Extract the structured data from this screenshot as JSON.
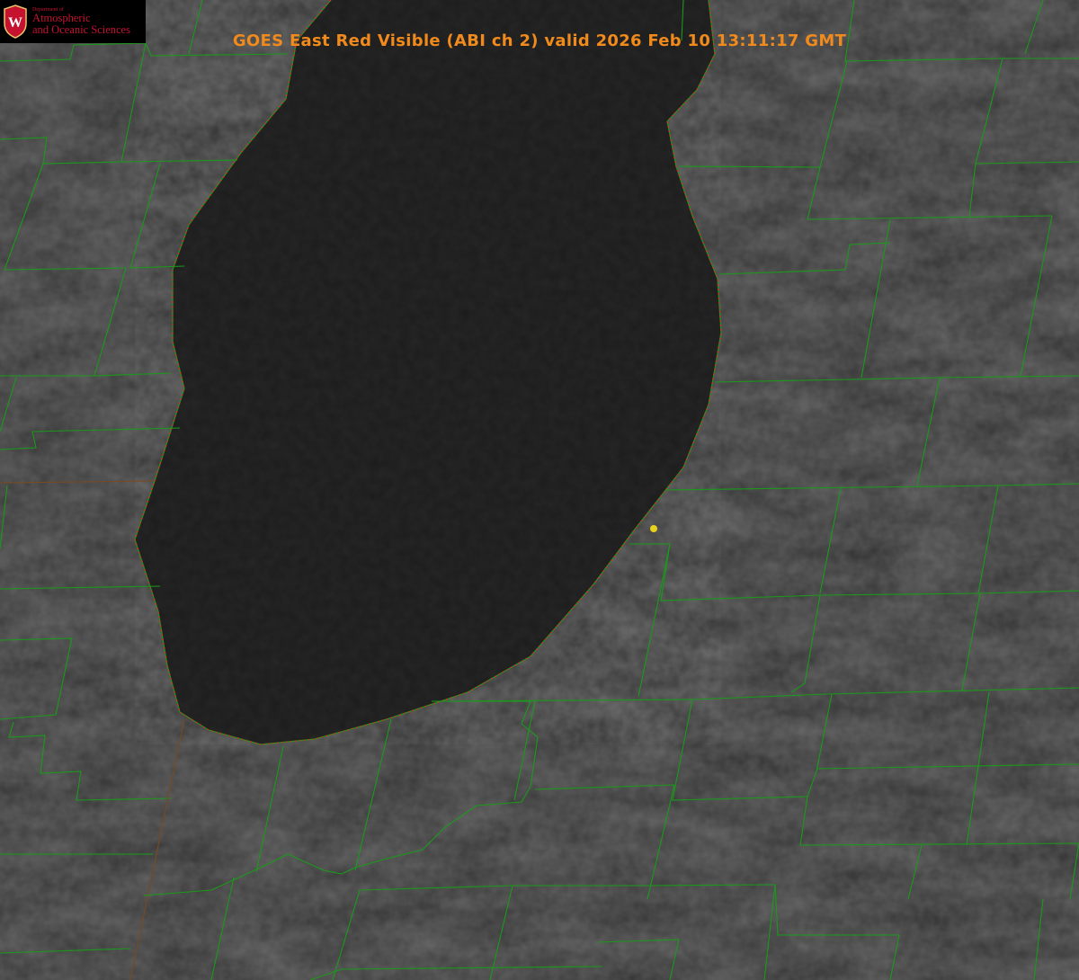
{
  "title": "GOES East Red Visible (ABI ch 2) valid 2026 Feb 10 13:11:17 GMT",
  "logo": {
    "dept": "Department of",
    "line1": "Atmospheric",
    "line2": "and Oceanic Sciences",
    "seal_letter": "W"
  },
  "colors": {
    "title": "#f08a1c",
    "county_lines": "#1a9a1a",
    "shoreline_dotted": "#d0302a",
    "marker": "#e8d21e",
    "logo_red": "#c4122f"
  }
}
